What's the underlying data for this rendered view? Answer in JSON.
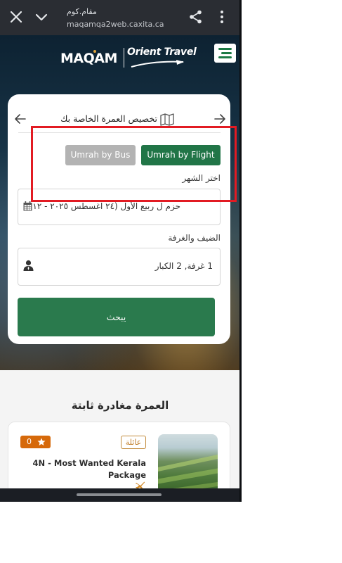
{
  "browser": {
    "title": "مقام.كوم",
    "url": "maqamqa2web.caxita.ca",
    "icons": [
      "close-icon",
      "chevron-down-icon",
      "share-icon",
      "more-vertical-icon"
    ]
  },
  "header": {
    "logo_left": "MAQAM",
    "logo_right": "Orient Travel"
  },
  "search_card": {
    "title": "تخصيص العمرة الخاصة بك",
    "mode_buttons": {
      "flight": "Umrah by Flight",
      "bus": "Umrah by Bus"
    },
    "month": {
      "label": "اختر الشهر",
      "value": "حزم ل ربيع الأول (٢٤ اغسطس ٢٠٢٥ - ١٢"
    },
    "guests": {
      "label": "الضيف والغرفة",
      "value": "1 غرفة, 2 الكبار"
    },
    "search_button": "يبحث"
  },
  "fixed_departure": {
    "section_title": "العمرة مغادرة ثابتة",
    "package": {
      "tag": "عائلة",
      "rating": "0",
      "title": "4N - Most Wanted Kerala Package"
    }
  },
  "colors": {
    "brand_green": "#217547",
    "disabled_grey": "#b3b3b3",
    "rating_orange": "#d6690a",
    "annotation_red": "#e21b23"
  }
}
